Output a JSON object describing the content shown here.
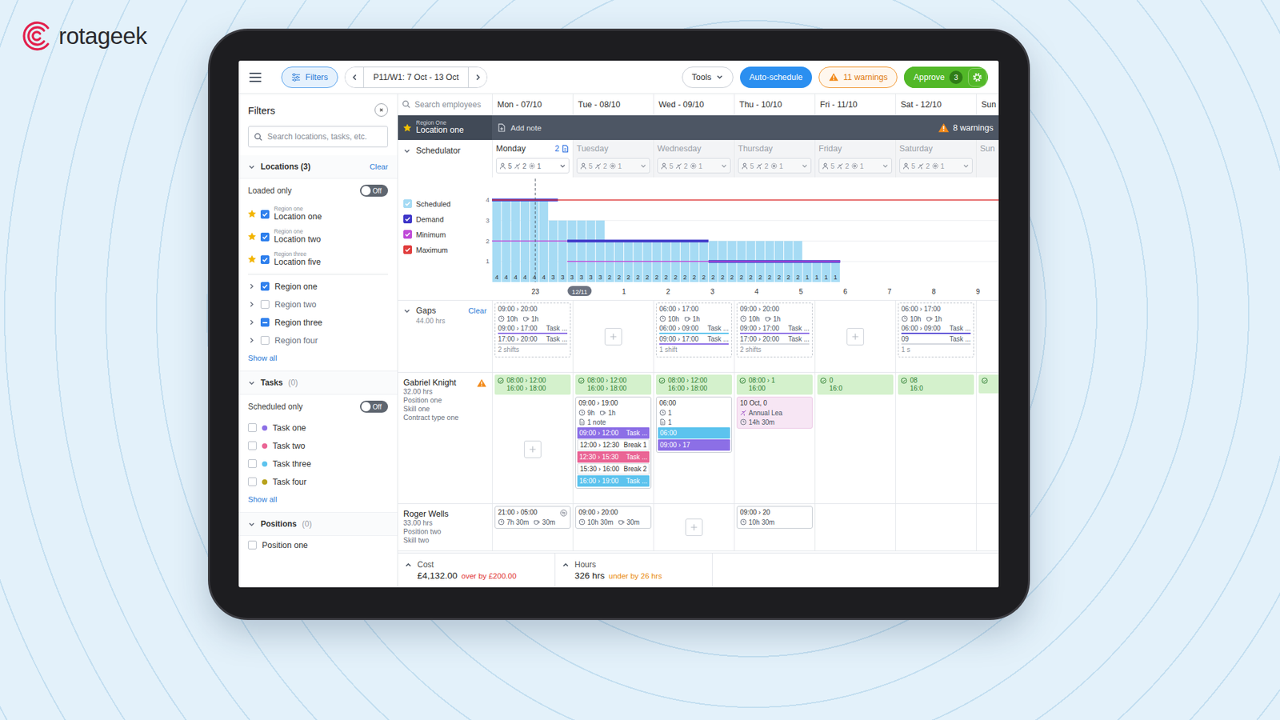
{
  "brand": {
    "name": "rotageek"
  },
  "toolbar": {
    "filters": "Filters",
    "period": "P11/W1: 7 Oct - 13 Oct",
    "tools": "Tools",
    "auto_schedule": "Auto-schedule",
    "warnings": "11 warnings",
    "approve": "Approve",
    "approve_count": "3"
  },
  "filters": {
    "title": "Filters",
    "search_placeholder": "Search locations, tasks, etc.",
    "locations": {
      "title": "Locations (3)",
      "expanded": true,
      "clear": "Clear",
      "toggle": {
        "label": "Loaded only",
        "on": false,
        "text": "Off"
      },
      "items": [
        {
          "region": "Region one",
          "name": "Location one",
          "starred": true,
          "checked": true
        },
        {
          "region": "Region one",
          "name": "Location two",
          "starred": true,
          "checked": true
        },
        {
          "region": "Region three",
          "name": "Location five",
          "starred": true,
          "checked": true
        }
      ],
      "regions": [
        {
          "name": "Region one",
          "checked": true,
          "indeterminate": false,
          "expanded": false
        },
        {
          "name": "Region two",
          "checked": false,
          "indeterminate": false,
          "expanded": false
        },
        {
          "name": "Region three",
          "checked": false,
          "indeterminate": true,
          "expanded": false
        },
        {
          "name": "Region four",
          "checked": false,
          "indeterminate": false,
          "expanded": false
        }
      ],
      "show_all": "Show all"
    },
    "tasks": {
      "title": "Tasks",
      "count": "(0)",
      "expanded": true,
      "toggle": {
        "label": "Scheduled only",
        "on": false,
        "text": "Off"
      },
      "items": [
        {
          "name": "Task one",
          "checked": false,
          "color": "#8c6fe6"
        },
        {
          "name": "Task two",
          "checked": false,
          "color": "#ea6595"
        },
        {
          "name": "Task three",
          "checked": false,
          "color": "#5cc3ee"
        },
        {
          "name": "Task four",
          "checked": false,
          "color": "#b8a21c"
        }
      ],
      "show_all": "Show all"
    },
    "positions": {
      "title": "Positions",
      "count": "(0)",
      "expanded": true,
      "items": [
        {
          "name": "Position one",
          "checked": false
        }
      ]
    }
  },
  "employee_search": "Search employees",
  "days": [
    "Mon - 07/10",
    "Tue - 08/10",
    "Wed - 09/10",
    "Thu - 10/10",
    "Fri - 11/10",
    "Sat - 12/10",
    "Sun"
  ],
  "location_bar": {
    "region": "Region One",
    "name": "Location one",
    "starred": true,
    "add_note": "Add note",
    "warnings": "8 warnings"
  },
  "scheduler": {
    "title": "Schedulator",
    "expanded": true,
    "days": [
      {
        "name": "Monday",
        "selected": true,
        "notes": "2",
        "staff": "5",
        "leave": "2",
        "other": "1"
      },
      {
        "name": "Tuesday",
        "selected": false,
        "staff": "5",
        "leave": "2",
        "other": "1"
      },
      {
        "name": "Wednesday",
        "selected": false,
        "staff": "5",
        "leave": "2",
        "other": "1"
      },
      {
        "name": "Thursday",
        "selected": false,
        "staff": "5",
        "leave": "2",
        "other": "1"
      },
      {
        "name": "Friday",
        "selected": false,
        "staff": "5",
        "leave": "2",
        "other": "1"
      },
      {
        "name": "Saturday",
        "selected": false,
        "staff": "5",
        "leave": "2",
        "other": "1"
      },
      {
        "name": "Sun",
        "selected": false
      }
    ],
    "chart": {
      "y_ticks": [
        "4",
        "3",
        "2",
        "1"
      ],
      "x_ticks": [
        {
          "label": "23",
          "selected": false
        },
        {
          "label": "12/11",
          "selected": true
        },
        {
          "label": "1",
          "selected": false
        },
        {
          "label": "2",
          "selected": false
        },
        {
          "label": "3",
          "selected": false
        },
        {
          "label": "4",
          "selected": false
        },
        {
          "label": "5",
          "selected": false
        },
        {
          "label": "6",
          "selected": false
        },
        {
          "label": "7",
          "selected": false
        },
        {
          "label": "8",
          "selected": false
        },
        {
          "label": "9",
          "selected": false
        }
      ],
      "bar_labels": [
        "4",
        "4",
        "4",
        "4",
        "4",
        "4",
        "3",
        "3",
        "3",
        "3",
        "3",
        "3",
        "2",
        "2",
        "2",
        "2",
        "2",
        "2",
        "2",
        "2",
        "2",
        "2",
        "2",
        "2",
        "2",
        "2",
        "2",
        "2",
        "2",
        "2",
        "2",
        "2",
        "2",
        "1",
        "1",
        "1",
        "1"
      ],
      "series": [
        {
          "label": "Scheduled",
          "checked": true,
          "kind": "bars",
          "color": "#a6dbf4",
          "values": [
            4,
            4,
            4,
            4,
            4,
            4,
            3,
            3,
            3,
            3,
            3,
            3,
            2,
            2,
            2,
            2,
            2,
            2,
            2,
            2,
            2,
            2,
            2,
            2,
            2,
            2,
            2,
            2,
            2,
            2,
            2,
            2,
            2,
            1,
            1,
            1,
            1,
            0,
            0,
            0,
            0,
            0,
            0,
            0,
            0,
            0,
            0,
            0,
            0,
            0,
            0,
            0,
            0,
            0,
            0,
            0,
            0,
            0,
            0,
            0
          ]
        },
        {
          "label": "Demand",
          "checked": true,
          "kind": "thick-line",
          "color": "#3f37c9",
          "values": [
            4,
            4,
            4,
            4,
            4,
            4,
            4,
            0,
            2,
            2,
            2,
            2,
            2,
            2,
            2,
            2,
            2,
            2,
            2,
            2,
            2,
            2,
            2,
            1,
            1,
            1,
            1,
            1,
            1,
            1,
            1,
            1,
            1,
            1,
            1,
            1,
            1,
            0,
            0,
            0,
            0,
            0,
            0,
            0,
            0,
            0,
            0,
            0,
            0,
            0,
            0,
            0,
            0,
            0,
            0,
            0,
            0,
            0,
            0,
            0
          ]
        },
        {
          "label": "Minimum",
          "checked": true,
          "kind": "line",
          "color": "#c04ad8",
          "values": [
            2,
            2,
            2,
            2,
            2,
            2,
            2,
            2,
            1,
            1,
            1,
            1,
            1,
            1,
            1,
            1,
            1,
            1,
            1,
            1,
            1,
            1,
            1,
            1,
            1,
            1,
            1,
            1,
            1,
            1,
            1,
            1,
            1,
            1,
            1,
            1,
            1,
            0,
            0,
            0,
            0,
            0,
            0,
            0,
            0,
            0,
            0,
            0,
            0,
            0,
            0,
            0,
            0,
            0,
            0,
            0,
            0,
            0,
            0,
            0
          ]
        },
        {
          "label": "Maximum",
          "checked": true,
          "kind": "line",
          "color": "#e03c3c",
          "values": [
            4,
            4,
            4,
            4,
            4,
            4,
            4,
            4,
            4,
            4,
            4,
            4,
            4,
            4,
            4,
            4,
            4,
            4,
            4,
            4,
            4,
            4,
            4,
            4,
            4,
            4,
            4,
            4,
            4,
            4,
            4,
            4,
            4,
            4,
            4,
            4,
            4,
            4,
            4,
            4,
            4,
            4,
            4,
            4,
            4,
            4,
            4,
            4,
            4,
            4,
            4,
            4,
            4,
            4,
            4,
            4,
            4,
            4,
            4,
            4
          ]
        }
      ]
    }
  },
  "gaps": {
    "title": "Gaps",
    "hours": "44.00 hrs",
    "clear": "Clear",
    "expanded": true,
    "days": [
      {
        "kind": "gap",
        "time": "09:00 › 20:00",
        "duration": "10h",
        "break": "1h",
        "count": "2 shifts",
        "tasks": [
          {
            "time": "09:00 › 17:00",
            "label": "Task ...",
            "color": "#8c6fe6"
          },
          {
            "time": "17:00 › 20:00",
            "label": "Task ...",
            "color": "#d3d7dd"
          }
        ]
      },
      {
        "kind": "add"
      },
      {
        "kind": "gap",
        "time": "06:00 › 17:00",
        "duration": "10h",
        "break": "1h",
        "count": "1 shift",
        "tasks": [
          {
            "time": "06:00 › 09:00",
            "label": "Task ...",
            "color": "#5cc3ee"
          },
          {
            "time": "09:00 › 17:00",
            "label": "Task ...",
            "color": "#8c6fe6"
          }
        ]
      },
      {
        "kind": "gap",
        "time": "09:00 › 20:00",
        "duration": "10h",
        "break": "1h",
        "count": "2 shifts",
        "tasks": [
          {
            "time": "09:00 › 17:00",
            "label": "Task ...",
            "color": "#8c6fe6"
          },
          {
            "time": "17:00 › 20:00",
            "label": "Task ...",
            "color": "#d3d7dd"
          }
        ]
      },
      {
        "kind": "add"
      },
      {
        "kind": "gap",
        "time": "06:00 › 17:00",
        "duration": "10h",
        "break": "1h",
        "count": "1 s",
        "tasks": [
          {
            "time": "06:00 › 09:00",
            "label": "Task ...",
            "color": "#5b4fd6"
          },
          {
            "time": "09",
            "label": "Task ...",
            "color": "#d3d7dd"
          }
        ]
      },
      {
        "kind": "none"
      }
    ]
  },
  "employees": [
    {
      "name": "Gabriel Knight",
      "warning": true,
      "hours": "32.00 hrs",
      "details": [
        "Position one",
        "Skill one",
        "Contract type one"
      ],
      "days": [
        {
          "availability": [
            "08:00 › 12:00",
            "16:00 › 18:00"
          ],
          "cards": [
            {
              "kind": "add"
            }
          ]
        },
        {
          "availability": [
            "08:00 › 12:00",
            "16:00 › 18:00"
          ],
          "cards": [
            {
              "kind": "shift",
              "time": "09:00 › 19:00",
              "duration": "9h",
              "break": "1h",
              "note": "1 note",
              "swap": false,
              "tasks": [
                {
                  "kind": "task",
                  "time": "09:00 › 12:00",
                  "label": "Task ...",
                  "color": "#8c6fe6"
                },
                {
                  "kind": "break",
                  "time": "12:00 › 12:30",
                  "label": "Break 1",
                  "color": "#ffffff"
                },
                {
                  "kind": "task",
                  "time": "12:30 › 15:30",
                  "label": "Task ...",
                  "color": "#ea6595"
                },
                {
                  "kind": "break",
                  "time": "15:30 › 16:00",
                  "label": "Break 2",
                  "color": "#ffffff"
                },
                {
                  "kind": "task",
                  "time": "16:00 › 19:00",
                  "label": "Task ...",
                  "color": "#5cc3ee"
                }
              ]
            }
          ]
        },
        {
          "availability": [
            "08:00 › 12:00",
            "16:00 › 18:00"
          ],
          "cards": [
            {
              "kind": "shift",
              "time": "06:00",
              "duration": "1",
              "note": "1",
              "swap": false,
              "tasks": [
                {
                  "kind": "task",
                  "time": "06:00",
                  "color": "#5cc3ee"
                },
                {
                  "kind": "task",
                  "time": "09:00 › 17",
                  "color": "#8c6fe6"
                }
              ]
            }
          ]
        },
        {
          "availability": [
            "08:00 › 1",
            "16:00"
          ],
          "cards": [
            {
              "kind": "leave",
              "date": "10 Oct, 0",
              "type": "Annual Lea",
              "duration": "14h 30m"
            }
          ]
        },
        {
          "availability": [
            "0",
            "16:0"
          ],
          "cards": []
        },
        {
          "availability": [
            "08",
            "16:0"
          ],
          "cards": []
        },
        {
          "availability": [],
          "cards": []
        }
      ]
    },
    {
      "name": "Roger Wells",
      "warning": false,
      "hours": "33.00 hrs",
      "details": [
        "Position two",
        "Skill two"
      ],
      "days": [
        {
          "availability": [],
          "cards": [
            {
              "kind": "shift",
              "time": "21:00 › 05:00",
              "duration": "7h 30m",
              "break": "30m",
              "swap": true,
              "tasks": []
            }
          ]
        },
        {
          "availability": [],
          "cards": [
            {
              "kind": "shift",
              "time": "09:00 › 20:00",
              "duration": "10h 30m",
              "break": "30m",
              "swap": false,
              "tasks": []
            }
          ]
        },
        {
          "availability": [],
          "cards": [
            {
              "kind": "add"
            }
          ]
        },
        {
          "availability": [],
          "cards": [
            {
              "kind": "shift",
              "time": "09:00 › 20",
              "duration": "10h 30m",
              "swap": false,
              "tasks": []
            }
          ]
        },
        {
          "availability": [],
          "cards": []
        },
        {
          "availability": [],
          "cards": []
        },
        {
          "availability": [],
          "cards": []
        }
      ]
    }
  ],
  "footer": [
    {
      "label": "Cost",
      "value": "£4,132.00",
      "delta": "over by £200.00",
      "color": "#e03131"
    },
    {
      "label": "Hours",
      "value": "326 hrs",
      "delta": "under by 26 hrs",
      "color": "#e8890c"
    }
  ]
}
